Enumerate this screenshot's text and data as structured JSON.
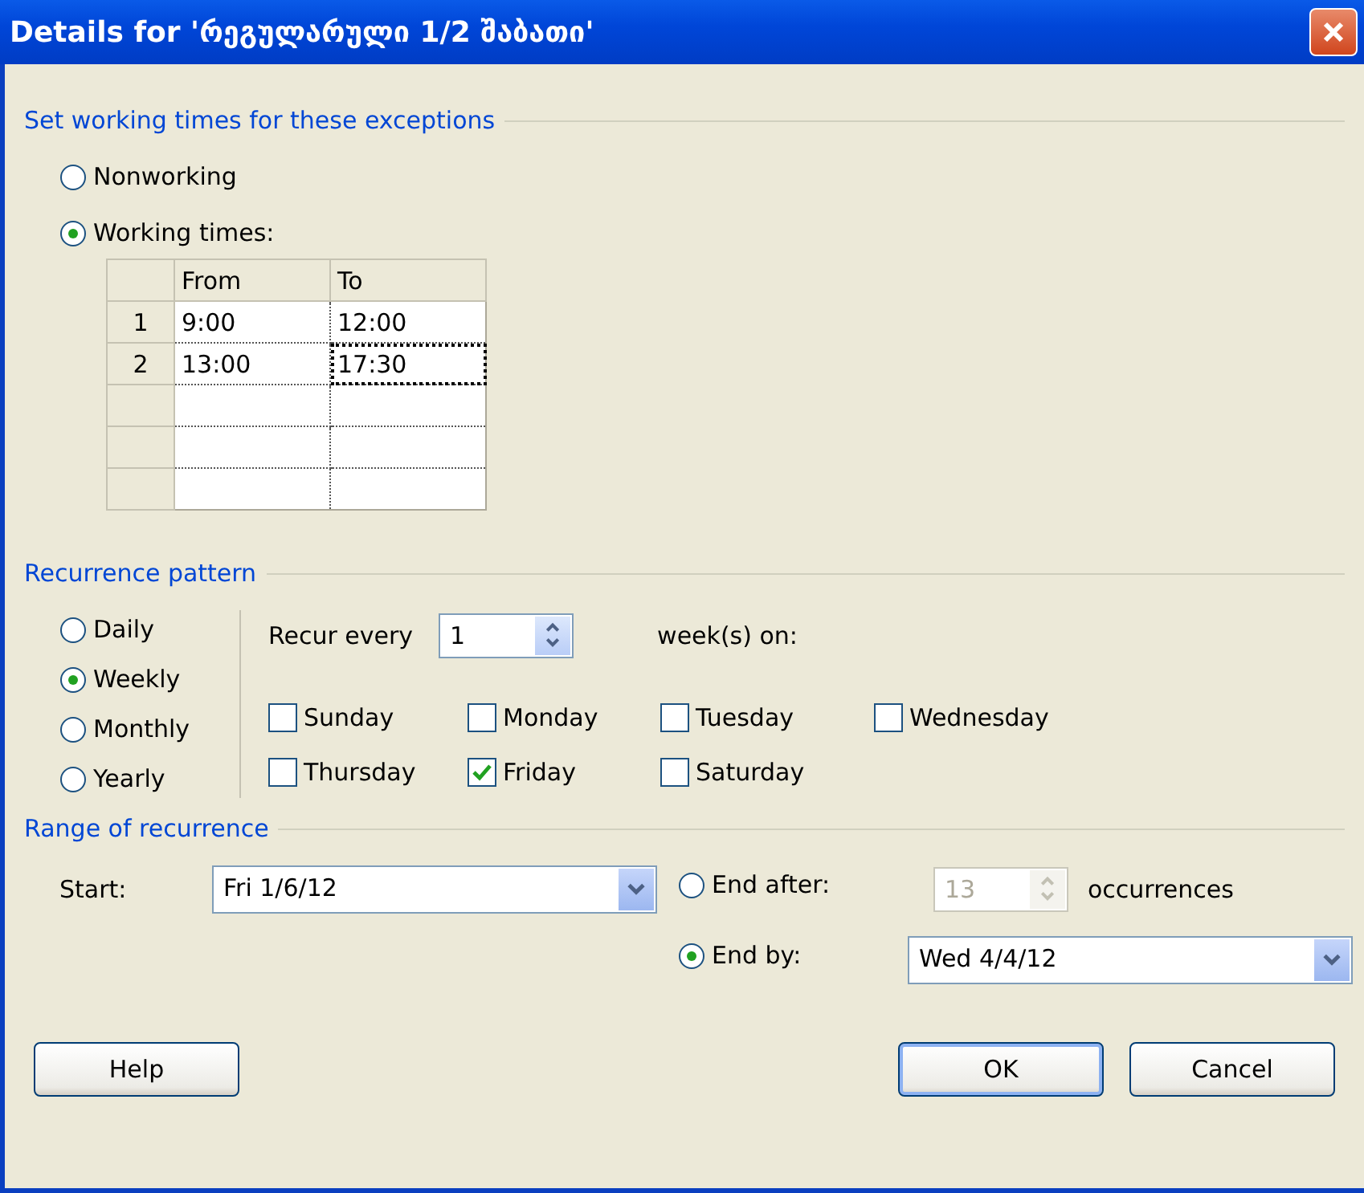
{
  "window": {
    "title": "Details for 'რეგულარული 1/2 შაბათი'"
  },
  "working_times": {
    "heading": "Set working times for these exceptions",
    "options": [
      {
        "label": "Nonworking",
        "selected": false
      },
      {
        "label": "Working times:",
        "selected": true
      }
    ],
    "table": {
      "columns": [
        "From",
        "To"
      ],
      "rows": [
        {
          "number": "1",
          "cells": [
            {
              "text": "9:00",
              "selected": false
            },
            {
              "text": "12:00",
              "selected": false
            }
          ]
        },
        {
          "number": "2",
          "cells": [
            {
              "text": "13:00",
              "selected": false
            },
            {
              "text": "17:30",
              "selected": true
            }
          ]
        }
      ]
    }
  },
  "recurrence": {
    "heading": "Recurrence pattern",
    "options": [
      {
        "label": "Daily",
        "selected": false
      },
      {
        "label": "Weekly",
        "selected": true
      },
      {
        "label": "Monthly",
        "selected": false
      },
      {
        "label": "Yearly",
        "selected": false
      }
    ],
    "recur_label": "Recur every",
    "recur_value": "1",
    "unit_label": "week(s) on:",
    "days": [
      {
        "label": "Sunday",
        "checked": false
      },
      {
        "label": "Monday",
        "checked": false
      },
      {
        "label": "Tuesday",
        "checked": false
      },
      {
        "label": "Wednesday",
        "checked": false
      },
      {
        "label": "Thursday",
        "checked": false
      },
      {
        "label": "Friday",
        "checked": true
      },
      {
        "label": "Saturday",
        "checked": false
      }
    ]
  },
  "range": {
    "heading": "Range of recurrence",
    "start_label": "Start:",
    "start_value": "Fri 1/6/12",
    "end_options": [
      {
        "label": "End after:",
        "selected": false
      },
      {
        "label": "End by:",
        "selected": true
      }
    ],
    "occurrences_value": "13",
    "occurrences_disabled": true,
    "occurrences_label": "occurrences",
    "end_by_value": "Wed 4/4/12"
  },
  "buttons": [
    {
      "label": "Help",
      "kind": "help"
    },
    {
      "label": "OK",
      "kind": "default"
    },
    {
      "label": "Cancel",
      "kind": "normal"
    }
  ]
}
